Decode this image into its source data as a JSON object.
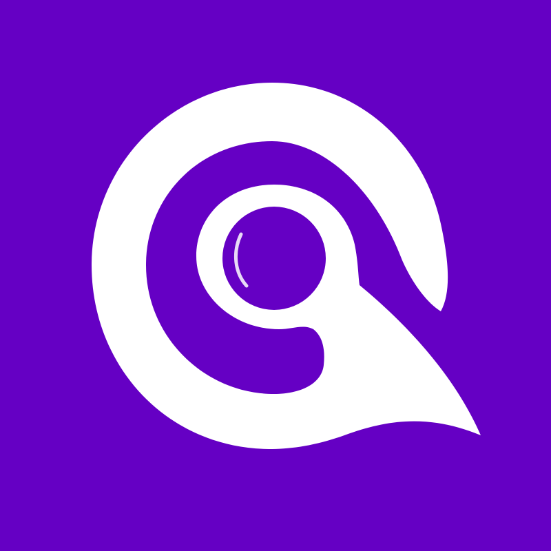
{
  "app_icon": {
    "icon": "spiral-eye-logo-icon",
    "colors": {
      "background": "#6500c4",
      "foreground": "#ffffff"
    }
  }
}
